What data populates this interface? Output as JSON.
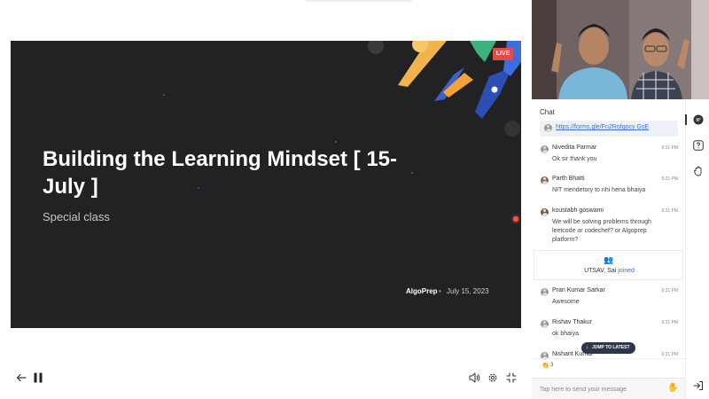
{
  "slide": {
    "title": "Building the Learning Mindset [ 15-July ]",
    "subtitle": "Special class",
    "live_label": "LIVE",
    "brand": "AlgoPrep",
    "separator": "•",
    "date": "July 15, 2023"
  },
  "controls": {
    "back_icon": "arrow-left-icon",
    "pause_icon": "pause-icon",
    "volume_icon": "volume-icon",
    "settings_icon": "gear-icon",
    "minimize_icon": "minimize-icon"
  },
  "chat": {
    "title": "Chat",
    "pinned_link": "https://forms.gle/Fn2Rofgocy GsE",
    "messages": [
      {
        "name": "Nivedita Parmar",
        "time": "9:31 PM",
        "text": "Ok sir thank you"
      },
      {
        "name": "Parth Bhatti",
        "time": "9:31 PM",
        "text": "NIT mendetory to nhi hena bhaiya"
      },
      {
        "name": "koustabh goswami",
        "time": "9:31 PM",
        "text": "We will be solving problems through leetcode or codechef? or Algoprep platform?"
      },
      {
        "name": "Pran Kumar Sarkar",
        "time": "9:31 PM",
        "text": "Awesome"
      },
      {
        "name": "Rishav Thakur",
        "time": "9:31 PM",
        "text": "ok bhaiya"
      },
      {
        "name": "Nishant Kumar",
        "time": "9:31 PM",
        "text": ""
      }
    ],
    "join_notice": {
      "names": "UTSAV, Sai",
      "action": "joined"
    },
    "jump_label": "JUMP TO LATEST",
    "reaction_count": "3",
    "input_placeholder": "Tap here to send your message"
  },
  "rail": {
    "chat_icon": "chat-icon",
    "question_icon": "question-icon",
    "poll_icon": "hand-icon",
    "exit_icon": "exit-icon"
  },
  "colors": {
    "slide_bg": "#222225",
    "live_red": "#e04b4b",
    "link_blue": "#3b6fd6",
    "jump_bg": "#2d3748"
  }
}
